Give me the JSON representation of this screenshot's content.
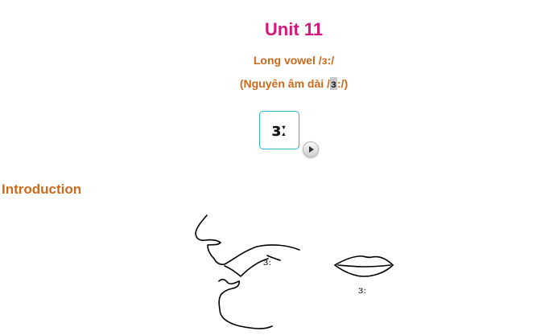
{
  "header": {
    "title": "Unit 11",
    "subtitle_en": "Long vowel /ɜ:/",
    "subtitle_vi_prefix": "(Nguyên âm dài /",
    "subtitle_vi_symbol": "ɜ",
    "subtitle_vi_suffix": ":/)"
  },
  "sound_card": {
    "symbol": "ɜː"
  },
  "section": {
    "heading": "Introduction"
  },
  "illustration": {
    "face_label": "ɜː",
    "lips_label": "ɜː"
  },
  "icons": {
    "play": "play-icon"
  },
  "colors": {
    "title": "#d4197a",
    "subtitle": "#cc6a1c",
    "card_border": "#2bb3d6"
  }
}
